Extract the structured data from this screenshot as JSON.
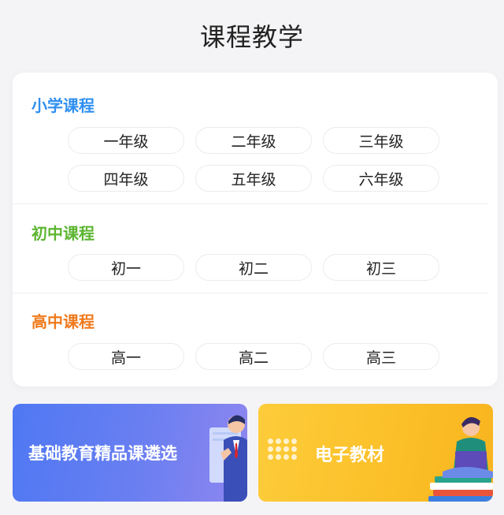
{
  "page": {
    "title": "课程教学"
  },
  "sections": {
    "primary": {
      "title": "小学课程",
      "color": "#2f8ff0",
      "grades": [
        "一年级",
        "二年级",
        "三年级",
        "四年级",
        "五年级",
        "六年级"
      ]
    },
    "junior": {
      "title": "初中课程",
      "color": "#5cb531",
      "grades": [
        "初一",
        "初二",
        "初三"
      ]
    },
    "senior": {
      "title": "高中课程",
      "color": "#f07a1c",
      "grades": [
        "高一",
        "高二",
        "高三"
      ]
    }
  },
  "banners": {
    "left": {
      "label": "基础教育精品课遴选",
      "icon": "teacher-illustration"
    },
    "right": {
      "label": "电子教材",
      "icon": "student-reading-illustration"
    }
  }
}
